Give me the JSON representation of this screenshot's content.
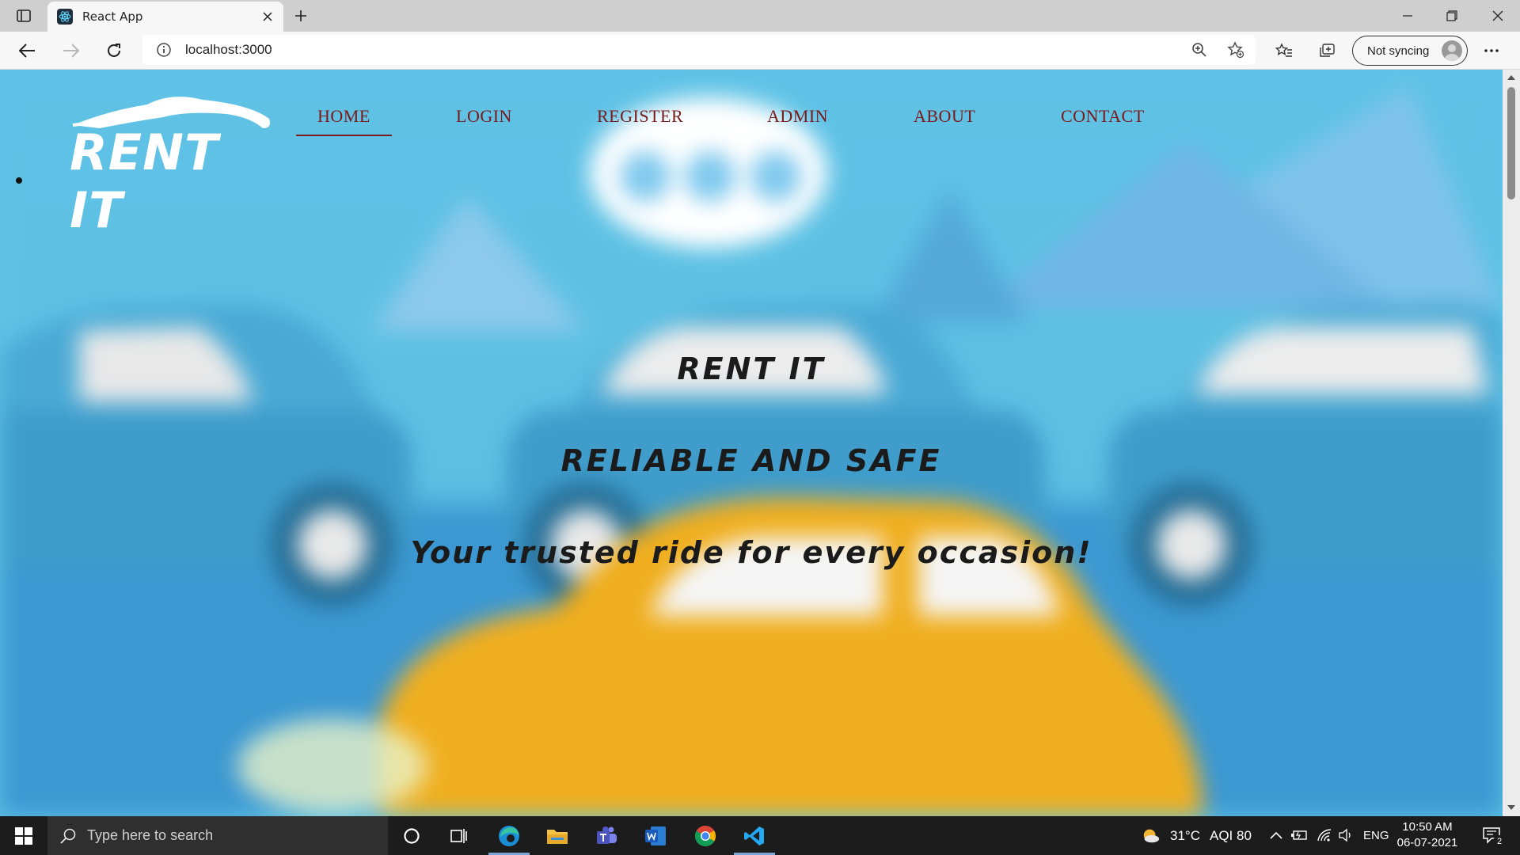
{
  "browser": {
    "tab": {
      "title": "React App",
      "favicon": "react-icon"
    },
    "address": {
      "url": "localhost:3000"
    },
    "sync_label": "Not syncing"
  },
  "page": {
    "logo_text": "RENT IT",
    "nav": [
      {
        "label": "HOME",
        "active": true
      },
      {
        "label": "LOGIN"
      },
      {
        "label": "REGISTER"
      },
      {
        "label": "ADMIN"
      },
      {
        "label": "ABOUT"
      },
      {
        "label": "CONTACT"
      }
    ],
    "hero": {
      "title": "RENT IT",
      "subtitle": "RELIABLE AND SAFE",
      "tagline": "Your trusted ride for every occasion!"
    }
  },
  "taskbar": {
    "search_placeholder": "Type here to search",
    "apps": [
      "cortana-icon",
      "task-view-icon",
      "edge-icon",
      "file-explorer-icon",
      "teams-icon",
      "word-icon",
      "chrome-icon",
      "vscode-icon"
    ],
    "weather": "31°C",
    "aqi": "AQI 80",
    "language": "ENG",
    "time": "10:50 AM",
    "date": "06-07-2021",
    "notification_count": "2"
  },
  "colors": {
    "sky": "#5ec3e6",
    "nav_text": "#7a1a1a",
    "hero_text": "#1b1b1b",
    "car_yellow": "#f0ae1e"
  }
}
